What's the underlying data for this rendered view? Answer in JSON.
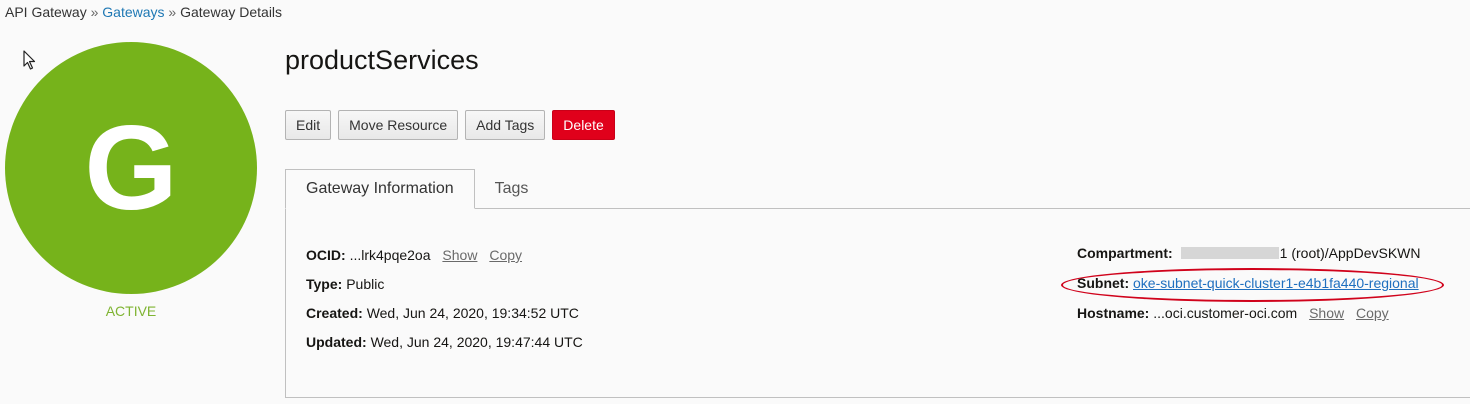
{
  "breadcrumb": {
    "root": "API Gateway",
    "separator": "»",
    "gateways": "Gateways",
    "current": "Gateway Details"
  },
  "resource": {
    "initial": "G",
    "state": "ACTIVE",
    "name": "productServices",
    "icon_color": "#76b31b"
  },
  "actions": {
    "edit": "Edit",
    "move": "Move Resource",
    "add_tags": "Add Tags",
    "delete": "Delete"
  },
  "tabs": {
    "info": "Gateway Information",
    "tags": "Tags"
  },
  "info": {
    "ocid_label": "OCID:",
    "ocid_value": "...lrk4pqe2oa",
    "show": "Show",
    "copy": "Copy",
    "type_label": "Type:",
    "type_value": "Public",
    "created_label": "Created:",
    "created_value": "Wed, Jun 24, 2020, 19:34:52 UTC",
    "updated_label": "Updated:",
    "updated_value": "Wed, Jun 24, 2020, 19:47:44 UTC",
    "compartment_label": "Compartment:",
    "compartment_suffix": "1 (root)/AppDevSKWN",
    "subnet_label": "Subnet:",
    "subnet_value": "oke-subnet-quick-cluster1-e4b1fa440-regional",
    "hostname_label": "Hostname:",
    "hostname_value": "...oci.customer-oci.com"
  },
  "colors": {
    "link": "#1f78b4",
    "danger": "#e0001b",
    "active": "#7fb432",
    "highlight": "#d0021b"
  }
}
